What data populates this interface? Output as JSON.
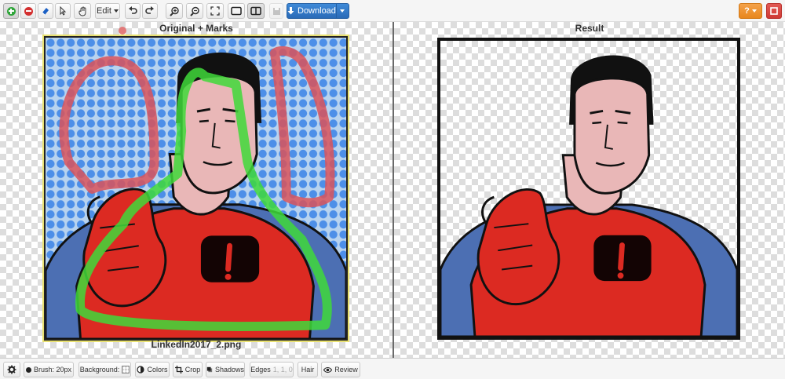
{
  "toolbar": {
    "edit_label": "Edit",
    "download_label": "Download",
    "help_label": "?"
  },
  "panes": {
    "left_title": "Original + Marks",
    "right_title": "Result",
    "filename": "LinkedIn2017_2.png"
  },
  "bottombar": {
    "brush_label": "Brush: 20px",
    "background_label": "Background:",
    "colors_label": "Colors",
    "crop_label": "Crop",
    "shadows_label": "Shadows",
    "edges_label": "Edges",
    "edges_values": "1, 1, 0",
    "hair_label": "Hair",
    "review_label": "Review"
  },
  "colors": {
    "accent": "#2a6bb8",
    "keep_mark": "#3fd93a",
    "remove_mark": "#d9535b",
    "hero_red": "#dc2a22",
    "halftone_blue": "#4d8fe8"
  }
}
